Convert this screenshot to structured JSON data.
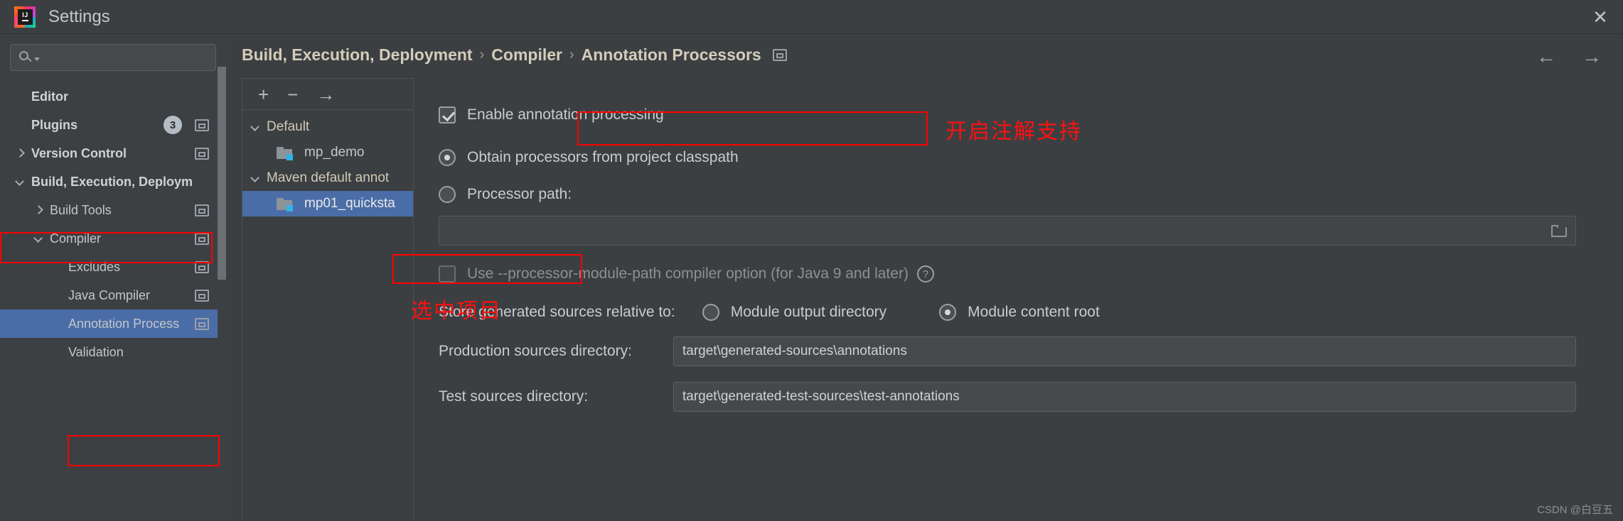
{
  "window": {
    "title": "Settings",
    "logo_text": "IJ",
    "close_label": "✕"
  },
  "search": {
    "value": "",
    "placeholder": ""
  },
  "sidebar": {
    "items": [
      {
        "label": "Editor",
        "arrow": "none",
        "bold": true,
        "indent": 0,
        "badge": null,
        "win_icon": false,
        "selected": false
      },
      {
        "label": "Plugins",
        "arrow": "none",
        "bold": true,
        "indent": 0,
        "badge": "3",
        "win_icon": true,
        "selected": false
      },
      {
        "label": "Version Control",
        "arrow": "right",
        "bold": true,
        "indent": 0,
        "badge": null,
        "win_icon": true,
        "selected": false
      },
      {
        "label": "Build, Execution, Deploym",
        "arrow": "down",
        "bold": true,
        "indent": 0,
        "badge": null,
        "win_icon": false,
        "selected": false
      },
      {
        "label": "Build Tools",
        "arrow": "right",
        "bold": false,
        "indent": 1,
        "badge": null,
        "win_icon": true,
        "selected": false
      },
      {
        "label": "Compiler",
        "arrow": "down",
        "bold": false,
        "indent": 1,
        "badge": null,
        "win_icon": true,
        "selected": false
      },
      {
        "label": "Excludes",
        "arrow": "none",
        "bold": false,
        "indent": 2,
        "badge": null,
        "win_icon": true,
        "selected": false
      },
      {
        "label": "Java Compiler",
        "arrow": "none",
        "bold": false,
        "indent": 2,
        "badge": null,
        "win_icon": true,
        "selected": false
      },
      {
        "label": "Annotation Process",
        "arrow": "none",
        "bold": false,
        "indent": 2,
        "badge": null,
        "win_icon": true,
        "selected": true
      },
      {
        "label": "Validation",
        "arrow": "none",
        "bold": false,
        "indent": 2,
        "badge": null,
        "win_icon": false,
        "selected": false
      }
    ]
  },
  "breadcrumb": {
    "parts": [
      "Build, Execution, Deployment",
      "Compiler",
      "Annotation Processors"
    ],
    "separator": "›"
  },
  "nav": {
    "back": "←",
    "forward": "→"
  },
  "module_panel": {
    "toolbar": {
      "add": "+",
      "remove": "−",
      "move": "→"
    },
    "nodes": [
      {
        "label": "Default",
        "type": "group",
        "arrow": "down",
        "selected": false
      },
      {
        "label": "mp_demo",
        "type": "module",
        "arrow": "none",
        "selected": false
      },
      {
        "label": "Maven default annot",
        "type": "group",
        "arrow": "down",
        "selected": false
      },
      {
        "label": "mp01_quicksta",
        "type": "module",
        "arrow": "none",
        "selected": true
      }
    ]
  },
  "settings_panel": {
    "enable_annotation_processing": {
      "label": "Enable annotation processing",
      "checked": true
    },
    "processor_source": {
      "options": [
        {
          "label": "Obtain processors from project classpath",
          "selected": true
        },
        {
          "label": "Processor path:",
          "selected": false
        }
      ],
      "processor_path_value": ""
    },
    "module_path_option": {
      "label": "Use --processor-module-path compiler option (for Java 9 and later)",
      "checked": false,
      "help": "?"
    },
    "store_generated": {
      "label": "Store generated sources relative to:",
      "options": [
        {
          "label": "Module output directory",
          "selected": false
        },
        {
          "label": "Module content root",
          "selected": true
        }
      ]
    },
    "production_sources": {
      "label": "Production sources directory:",
      "value": "target\\generated-sources\\annotations"
    },
    "test_sources": {
      "label": "Test sources directory:",
      "value": "target\\generated-test-sources\\test-annotations"
    }
  },
  "annotations": {
    "enable_note": "开启注解支持",
    "select_project_note": "选中项目",
    "box_color": "#ff0000"
  },
  "watermark": {
    "text": "CSDN @白豆五"
  }
}
